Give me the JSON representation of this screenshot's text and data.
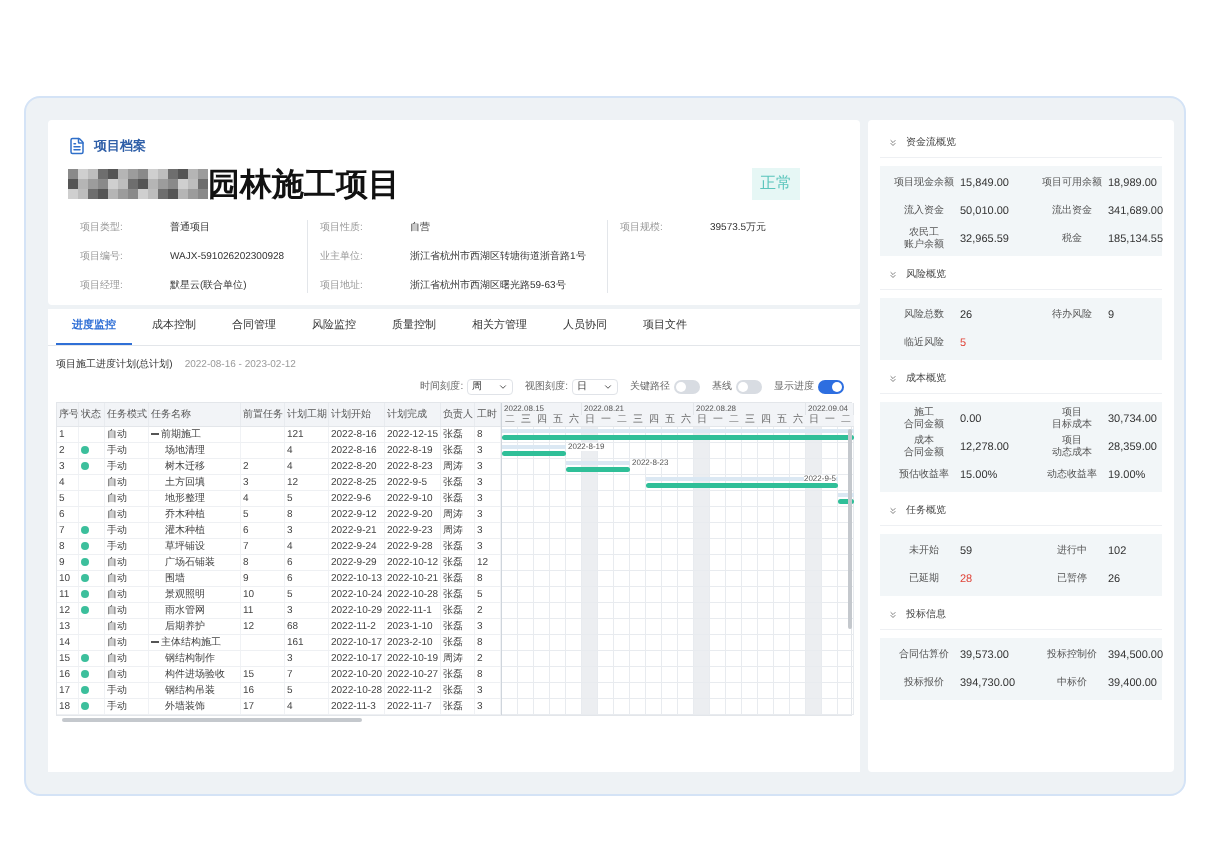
{
  "header": {
    "section_title": "项目档案",
    "project_name": "园林施工项目",
    "status": "正常",
    "columns": [
      [
        {
          "label": "项目类型:",
          "value": "普通项目"
        },
        {
          "label": "项目编号:",
          "value": "WAJX-591026202300928"
        },
        {
          "label": "项目经理:",
          "value": "默星云(联合单位)"
        }
      ],
      [
        {
          "label": "项目性质:",
          "value": "自营"
        },
        {
          "label": "业主单位:",
          "value": "浙江省杭州市西湖区转塘街道浙音路1号"
        },
        {
          "label": "项目地址:",
          "value": "浙江省杭州市西湖区曙光路59-63号"
        }
      ],
      [
        {
          "label": "项目规模:",
          "value": "39573.5万元"
        }
      ]
    ]
  },
  "tabs": [
    {
      "label": "进度监控",
      "selected": true
    },
    {
      "label": "成本控制",
      "selected": false
    },
    {
      "label": "合同管理",
      "selected": false
    },
    {
      "label": "风险监控",
      "selected": false
    },
    {
      "label": "质量控制",
      "selected": false
    },
    {
      "label": "相关方管理",
      "selected": false
    },
    {
      "label": "人员协同",
      "selected": false
    },
    {
      "label": "项目文件",
      "selected": false
    }
  ],
  "schedule": {
    "title": "项目施工进度计划(总计划)",
    "date_range": "2022-08-16 - 2023-02-12",
    "controls": [
      {
        "kind": "select",
        "label": "时间刻度:",
        "value": "周"
      },
      {
        "kind": "select",
        "label": "视图刻度:",
        "value": "日"
      },
      {
        "kind": "toggle",
        "label": "关键路径",
        "on": false
      },
      {
        "kind": "toggle",
        "label": "基线",
        "on": false
      },
      {
        "kind": "toggle",
        "label": "显示进度",
        "on": true
      }
    ],
    "table": {
      "columns": [
        "序号",
        "状态",
        "任务模式",
        "任务名称",
        "前置任务",
        "计划工期",
        "计划开始",
        "计划完成",
        "负责人",
        "工时"
      ],
      "rows": [
        {
          "no": "1",
          "done": false,
          "mode": "自动",
          "name": "前期施工",
          "duration": "121",
          "start": "2022-8-16",
          "end": "2022-12-15",
          "owner": "张磊",
          "column_10": "8",
          "expanded": true,
          "children": [
            {
              "no": "2",
              "done": true,
              "mode": "手动",
              "name": "场地清理",
              "duration": "4",
              "start": "2022-8-16",
              "end": "2022-8-19",
              "owner": "张磊",
              "column_10": "3",
              "bar_label": "2022-8-19"
            },
            {
              "no": "3",
              "done": true,
              "mode": "手动",
              "name": "树木迁移",
              "pred": "2",
              "duration": "4",
              "start": "2022-8-20",
              "end": "2022-8-23",
              "owner": "周涛",
              "column_10": "3",
              "bar_label": "2022-8-23"
            },
            {
              "no": "4",
              "done": false,
              "mode": "自动",
              "name": "土方回填",
              "pred": "3",
              "duration": "12",
              "start": "2022-8-25",
              "end": "2022-9-5",
              "owner": "张磊",
              "column_10": "3",
              "bar_label": "2022-9-5"
            },
            {
              "no": "5",
              "done": false,
              "mode": "自动",
              "name": "地形整理",
              "pred": "4",
              "duration": "5",
              "start": "2022-9-6",
              "end": "2022-9-10",
              "owner": "张磊",
              "column_10": "3"
            },
            {
              "no": "6",
              "done": false,
              "mode": "自动",
              "name": "乔木种植",
              "pred": "5",
              "duration": "8",
              "start": "2022-9-12",
              "end": "2022-9-20",
              "owner": "周涛",
              "column_10": "3"
            },
            {
              "no": "7",
              "done": true,
              "mode": "手动",
              "name": "灌木种植",
              "pred": "6",
              "duration": "3",
              "start": "2022-9-21",
              "end": "2022-9-23",
              "owner": "周涛",
              "column_10": "3"
            },
            {
              "no": "8",
              "done": true,
              "mode": "手动",
              "name": "草坪铺设",
              "pred": "7",
              "duration": "4",
              "start": "2022-9-24",
              "end": "2022-9-28",
              "owner": "张磊",
              "column_10": "3"
            },
            {
              "no": "9",
              "done": true,
              "mode": "自动",
              "name": "广场石铺装",
              "pred": "8",
              "duration": "6",
              "start": "2022-9-29",
              "end": "2022-10-12",
              "owner": "张磊",
              "column_10": "12"
            },
            {
              "no": "10",
              "done": true,
              "mode": "自动",
              "name": "围墙",
              "pred": "9",
              "duration": "6",
              "start": "2022-10-13",
              "end": "2022-10-21",
              "owner": "张磊",
              "column_10": "8"
            },
            {
              "no": "11",
              "done": true,
              "mode": "自动",
              "name": "景观照明",
              "pred": "10",
              "duration": "5",
              "start": "2022-10-24",
              "end": "2022-10-28",
              "owner": "张磊",
              "column_10": "5"
            },
            {
              "no": "12",
              "done": true,
              "mode": "自动",
              "name": "雨水管网",
              "pred": "11",
              "duration": "3",
              "start": "2022-10-29",
              "end": "2022-11-1",
              "owner": "张磊",
              "column_10": "2"
            },
            {
              "no": "13",
              "done": false,
              "mode": "自动",
              "name": "后期养护",
              "pred": "12",
              "duration": "68",
              "start": "2022-11-2",
              "end": "2023-1-10",
              "owner": "张磊",
              "column_10": "3"
            }
          ]
        },
        {
          "no": "14",
          "done": false,
          "mode": "自动",
          "name": "主体结构施工",
          "duration": "161",
          "start": "2022-10-17",
          "end": "2023-2-10",
          "owner": "张磊",
          "column_10": "8",
          "expanded": true,
          "children": [
            {
              "no": "15",
              "done": true,
              "mode": "自动",
              "name": "钢结构制作",
              "duration": "3",
              "start": "2022-10-17",
              "end": "2022-10-19",
              "owner": "周涛",
              "column_10": "2"
            },
            {
              "no": "16",
              "done": true,
              "mode": "自动",
              "name": "构件进场验收",
              "pred": "15",
              "duration": "7",
              "start": "2022-10-20",
              "end": "2022-10-27",
              "owner": "张磊",
              "column_10": "8"
            },
            {
              "no": "17",
              "done": true,
              "mode": "手动",
              "name": "钢结构吊装",
              "pred": "16",
              "duration": "5",
              "start": "2022-10-28",
              "end": "2022-11-2",
              "owner": "张磊",
              "column_10": "3"
            },
            {
              "no": "18",
              "done": true,
              "mode": "手动",
              "name": "外墙装饰",
              "pred": "17",
              "duration": "4",
              "start": "2022-11-3",
              "end": "2022-11-7",
              "owner": "张磊",
              "column_10": "3"
            }
          ]
        }
      ]
    },
    "gantt": {
      "weeks": [
        {
          "label": "2022.08.15",
          "days": [
            "二",
            "三",
            "四",
            "五",
            "六"
          ]
        },
        {
          "label": "2022.08.21",
          "days": [
            "日",
            "一",
            "二",
            "三",
            "四",
            "五",
            "六"
          ]
        },
        {
          "label": "2022.08.28",
          "days": [
            "日",
            "一",
            "二",
            "三",
            "四",
            "五",
            "六"
          ]
        },
        {
          "label": "2022.09.04",
          "days": [
            "日",
            "一",
            "二"
          ]
        }
      ]
    }
  },
  "overview": [
    {
      "title": "资金流概览",
      "items": [
        {
          "label": "项目现金余额",
          "value": "15,849.00",
          "alert": false
        },
        {
          "label": "项目可用余额",
          "value": "18,989.00",
          "alert": false
        },
        {
          "label": "流入资金",
          "value": "50,010.00",
          "alert": false
        },
        {
          "label": "流出资金",
          "value": "341,689.00",
          "alert": false
        },
        {
          "label_lines": [
            "农民工",
            "账户余额"
          ],
          "value": "32,965.59",
          "alert": false
        },
        {
          "label": "税金",
          "value": "185,134.55",
          "alert": false
        }
      ]
    },
    {
      "title": "风险概览",
      "items": [
        {
          "label": "风险总数",
          "value": "26",
          "alert": false
        },
        {
          "label": "待办风险",
          "value": "9",
          "alert": false
        },
        {
          "label": "临近风险",
          "value": "5",
          "alert": true
        }
      ]
    },
    {
      "title": "成本概览",
      "items": [
        {
          "label_lines": [
            "施工",
            "合同金额"
          ],
          "value": "0.00",
          "alert": false
        },
        {
          "label_lines": [
            "项目",
            "目标成本"
          ],
          "value": "30,734.00",
          "alert": false
        },
        {
          "label_lines": [
            "成本",
            "合同金额"
          ],
          "value": "12,278.00",
          "alert": false
        },
        {
          "label_lines": [
            "项目",
            "动态成本"
          ],
          "value": "28,359.00",
          "alert": false
        },
        {
          "label": "预估收益率",
          "value": "15.00%",
          "alert": false
        },
        {
          "label": "动态收益率",
          "value": "19.00%",
          "alert": false
        }
      ]
    },
    {
      "title": "任务概览",
      "items": [
        {
          "label": "未开始",
          "value": "59",
          "alert": false
        },
        {
          "label": "进行中",
          "value": "102",
          "alert": false
        },
        {
          "label": "已延期",
          "value": "28",
          "alert": true
        },
        {
          "label": "已暂停",
          "value": "26",
          "alert": false
        }
      ]
    },
    {
      "title": "投标信息",
      "items": [
        {
          "label": "合同估算价",
          "value": "39,573.00",
          "alert": false
        },
        {
          "label": "投标控制价",
          "value": "394,500.00",
          "alert": false
        },
        {
          "label": "投标报价",
          "value": "394,730.00",
          "alert": false
        },
        {
          "label": "中标价",
          "value": "39,400.00",
          "alert": false
        }
      ]
    }
  ]
}
